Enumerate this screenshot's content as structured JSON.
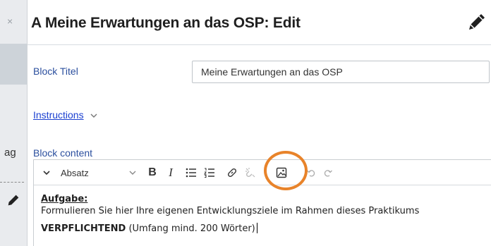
{
  "background": {
    "partial_text": "ag"
  },
  "modal": {
    "title": "A Meine Erwartungen an das OSP: Edit",
    "close_glyph": "×",
    "block_title_label": "Block Titel",
    "block_title_value": "Meine Erwartungen an das OSP",
    "instructions_label": "Instructions",
    "block_content_label": "Block content"
  },
  "toolbar": {
    "format_select": "Absatz",
    "bold": "B",
    "italic": "I"
  },
  "content": {
    "heading": "Aufgabe:",
    "task": "Formulieren Sie hier Ihre eigenen Entwicklungsziele im Rahmen dieses Praktikums",
    "requirement_bold": "VERPFLICHTEND",
    "requirement_rest": " (Umfang mind. 200 Wörter)"
  },
  "colors": {
    "label_blue": "#2b4f9e",
    "link_blue": "#1a3fd0",
    "highlight_orange": "#e8832a"
  },
  "icons": [
    "close-icon",
    "pencil-icon",
    "chevron-down-icon",
    "bold-icon",
    "italic-icon",
    "bulleted-list-icon",
    "numbered-list-icon",
    "link-icon",
    "unlink-icon",
    "image-icon",
    "undo-icon",
    "redo-icon"
  ]
}
